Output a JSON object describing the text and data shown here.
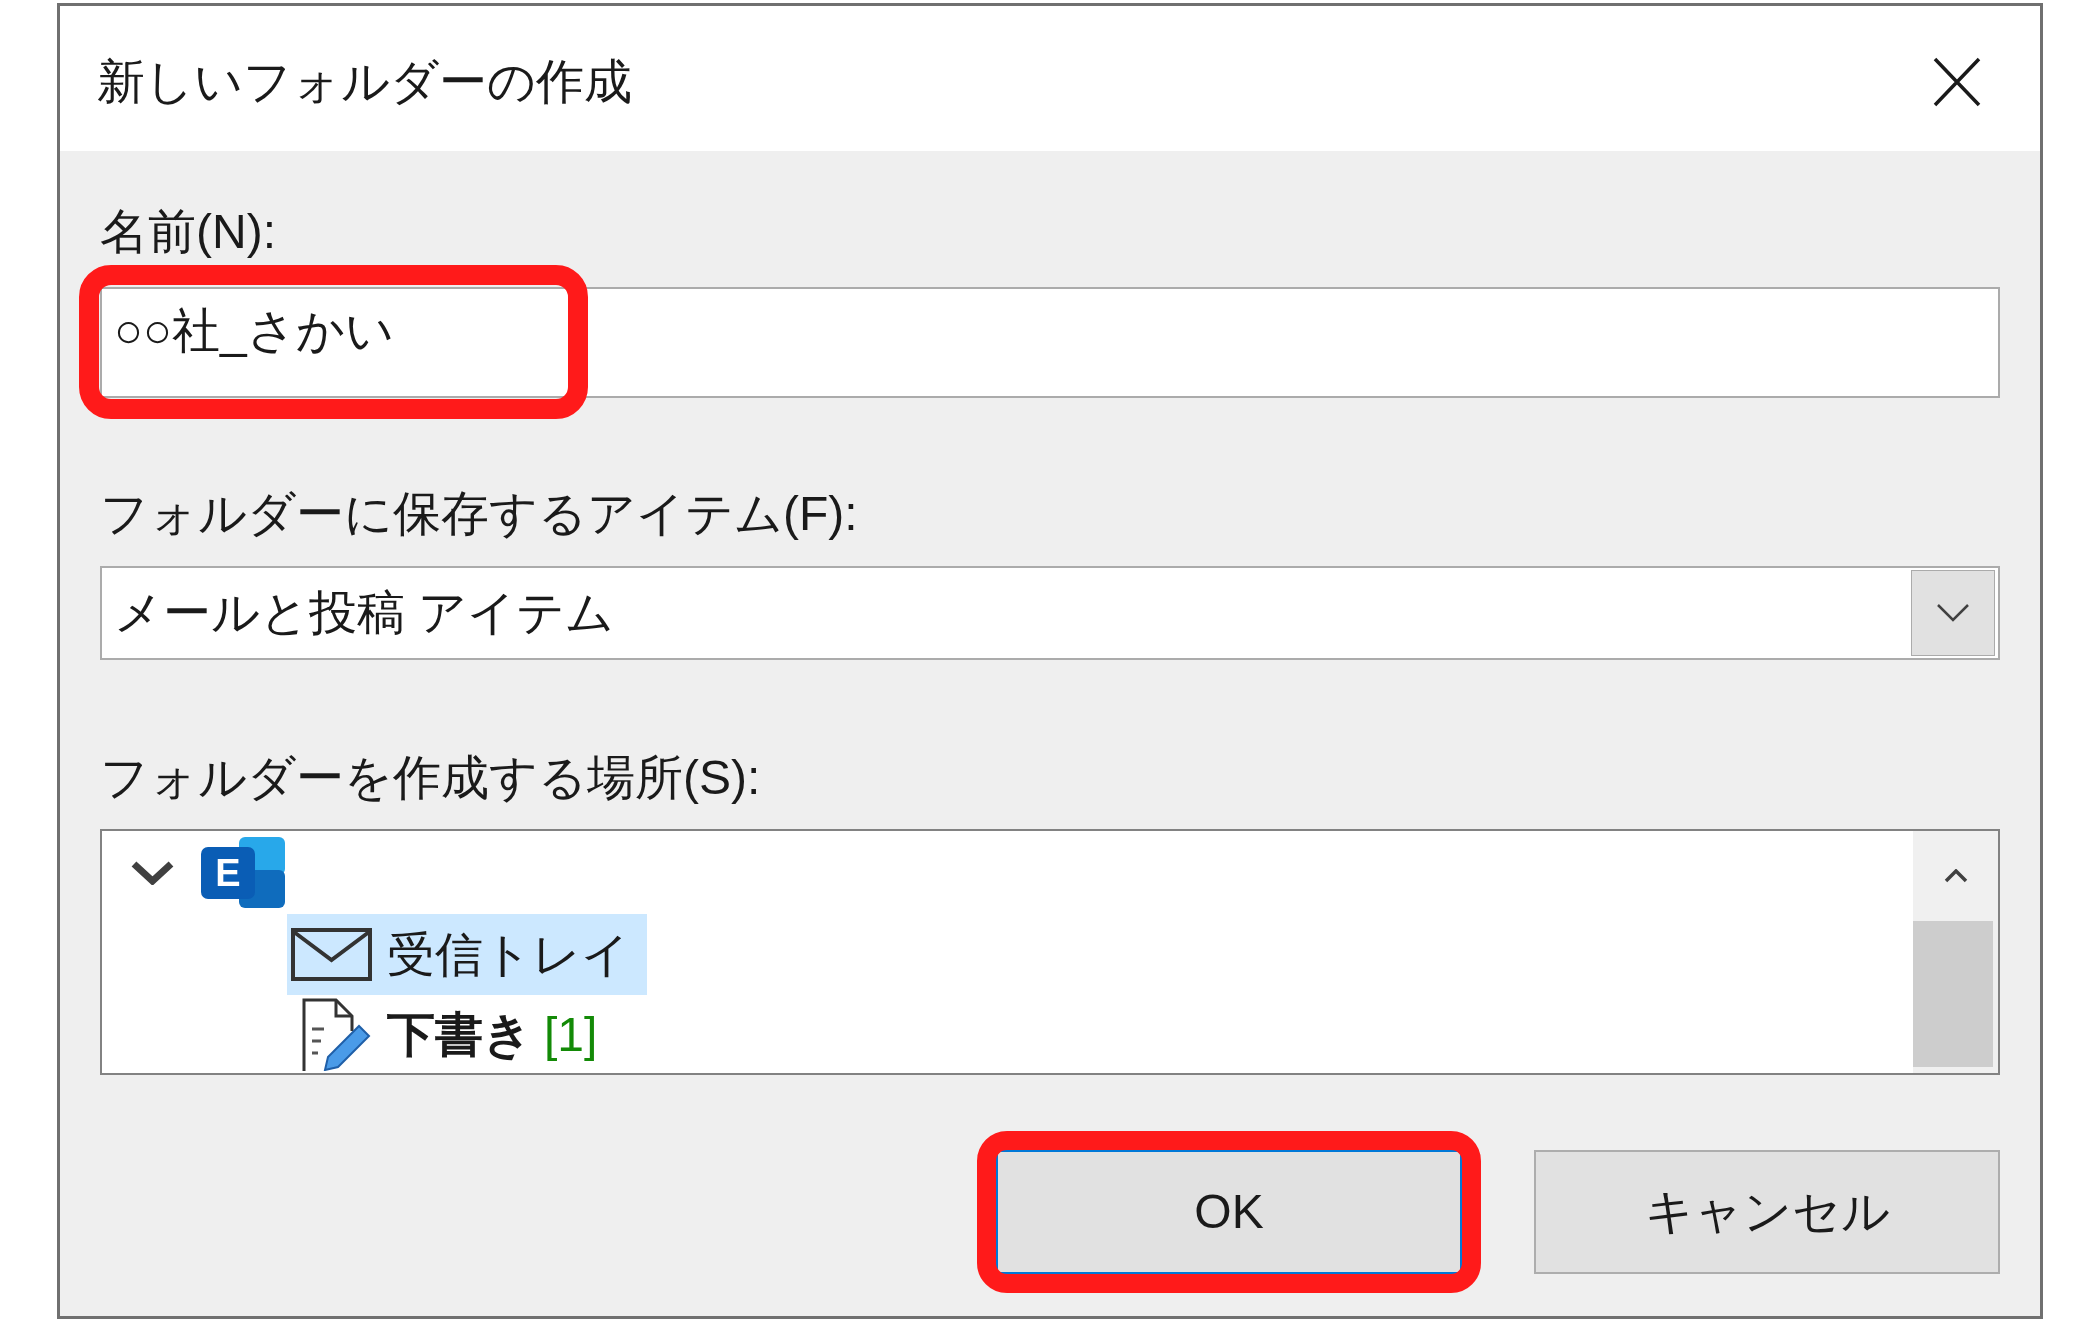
{
  "window": {
    "title": "新しいフォルダーの作成"
  },
  "name_field": {
    "label": "名前(N):",
    "value": "○○社_さかい",
    "highlighted": true
  },
  "item_type": {
    "label": "フォルダーに保存するアイテム(F):",
    "value": "メールと投稿 アイテム"
  },
  "location": {
    "label": "フォルダーを作成する場所(S):",
    "tree": [
      {
        "kind": "account",
        "logo_letter": "E",
        "expanded": true,
        "selected": false,
        "children": [
          {
            "kind": "inbox",
            "label": "受信トレイ",
            "selected": true,
            "unread": false
          },
          {
            "kind": "drafts",
            "label": "下書き",
            "count": "[1]",
            "selected": false,
            "unread": true
          }
        ]
      }
    ]
  },
  "buttons": [
    {
      "label": "OK",
      "default": true,
      "highlighted": true
    },
    {
      "label": "キャンセル",
      "default": false,
      "highlighted": false
    }
  ]
}
